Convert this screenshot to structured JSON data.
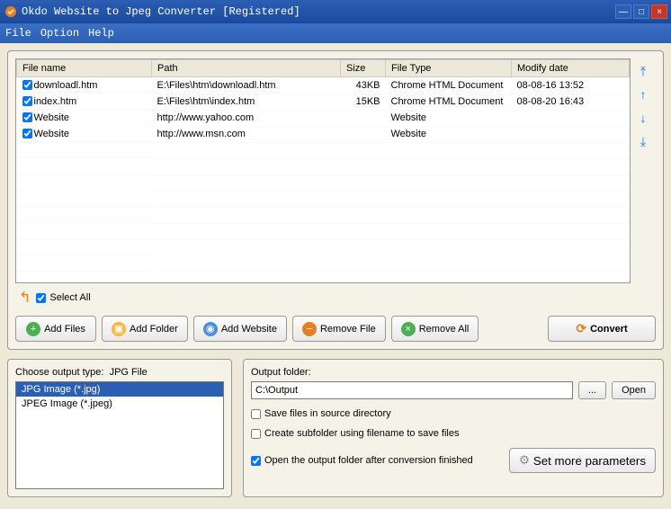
{
  "titlebar": {
    "title": "Okdo Website to Jpeg Converter [Registered]"
  },
  "menu": {
    "file": "File",
    "option": "Option",
    "help": "Help"
  },
  "table": {
    "headers": {
      "filename": "File name",
      "path": "Path",
      "size": "Size",
      "filetype": "File Type",
      "modify": "Modify date"
    },
    "rows": [
      {
        "name": "downloadl.htm",
        "path": "E:\\Files\\htm\\downloadl.htm",
        "size": "43KB",
        "type": "Chrome HTML Document",
        "date": "08-08-16 13:52"
      },
      {
        "name": "index.htm",
        "path": "E:\\Files\\htm\\index.htm",
        "size": "15KB",
        "type": "Chrome HTML Document",
        "date": "08-08-20 16:43"
      },
      {
        "name": "Website",
        "path": "http://www.yahoo.com",
        "size": "",
        "type": "Website",
        "date": ""
      },
      {
        "name": "Website",
        "path": "http://www.msn.com",
        "size": "",
        "type": "Website",
        "date": ""
      }
    ]
  },
  "selectall": "Select All",
  "buttons": {
    "addfiles": "Add Files",
    "addfolder": "Add Folder",
    "addwebsite": "Add Website",
    "removefile": "Remove File",
    "removeall": "Remove All",
    "convert": "Convert"
  },
  "output_type": {
    "label": "Choose output type:",
    "current": "JPG File",
    "items": [
      "JPG Image (*.jpg)",
      "JPEG Image (*.jpeg)"
    ]
  },
  "output_folder": {
    "label": "Output folder:",
    "value": "C:\\Output",
    "browse": "...",
    "open": "Open",
    "save_source": "Save files in source directory",
    "create_sub": "Create subfolder using filename to save files",
    "open_after": "Open the output folder after conversion finished",
    "set_params": "Set more parameters"
  }
}
